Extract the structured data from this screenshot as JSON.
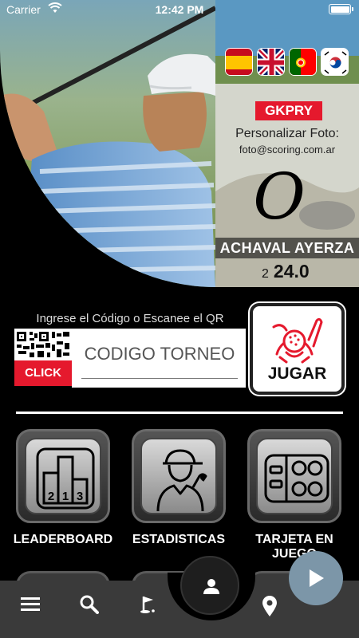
{
  "status_bar": {
    "carrier": "Carrier",
    "time": "12:42 PM"
  },
  "profile": {
    "languages": [
      {
        "name": "spanish-flag"
      },
      {
        "name": "uk-flag"
      },
      {
        "name": "portugal-flag"
      },
      {
        "name": "korea-flag"
      }
    ],
    "user_code": "GKPRY",
    "photo_label": "Personalizar Foto:",
    "photo_email": "foto@scoring.com.ar",
    "initial": "O",
    "player_name": "ACHAVAL AYERZA",
    "handicap_label": "2",
    "handicap_value": "24.0"
  },
  "code_entry": {
    "prompt": "Ingrese el Código o Escanee el QR",
    "click_label": "CLICK",
    "placeholder": "CODIGO TORNEO",
    "play_label": "JUGAR"
  },
  "tiles": [
    {
      "label": "LEADERBOARD",
      "icon": "podium-icon"
    },
    {
      "label": "ESTADISTICAS",
      "icon": "golfer-icon"
    },
    {
      "label": "TARJETA EN JUEGO",
      "icon": "scorecard-icon"
    }
  ],
  "colors": {
    "accent_red": "#e5192d",
    "nav_bg": "#3a3a3a",
    "play_fab": "#7c96a8"
  }
}
